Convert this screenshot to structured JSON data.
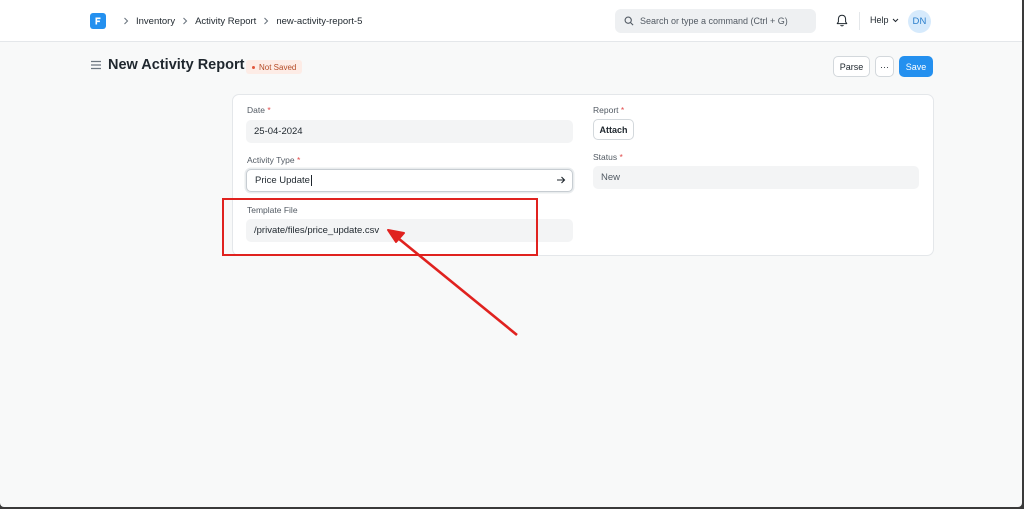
{
  "breadcrumbs": [
    "Inventory",
    "Activity Report",
    "new-activity-report-5"
  ],
  "search": {
    "placeholder": "Search or type a command (Ctrl + G)"
  },
  "navbar": {
    "help_label": "Help",
    "avatar_initials": "DN"
  },
  "page": {
    "title": "New Activity Report",
    "status_badge": "Not Saved"
  },
  "actions": {
    "parse_label": "Parse",
    "more_label": "···",
    "save_label": "Save"
  },
  "form": {
    "date": {
      "label": "Date",
      "required_mark": "*",
      "value": "25-04-2024"
    },
    "activity_type": {
      "label": "Activity Type",
      "required_mark": "*",
      "value": "Price Update"
    },
    "template_file": {
      "label": "Template File",
      "value": "/private/files/price_update.csv"
    },
    "report": {
      "label": "Report",
      "required_mark": "*",
      "button_label": "Attach"
    },
    "status": {
      "label": "Status",
      "required_mark": "*",
      "value": "New"
    }
  },
  "colors": {
    "primary": "#2490ef",
    "annotation_red": "#e0221f",
    "badge_text": "#b44b26",
    "badge_bg": "#fdece6"
  },
  "icons": [
    "app-logo-icon",
    "chevron-right-icon",
    "search-icon",
    "bell-icon",
    "chevron-down-icon",
    "hamburger-icon",
    "arrow-right-icon"
  ]
}
